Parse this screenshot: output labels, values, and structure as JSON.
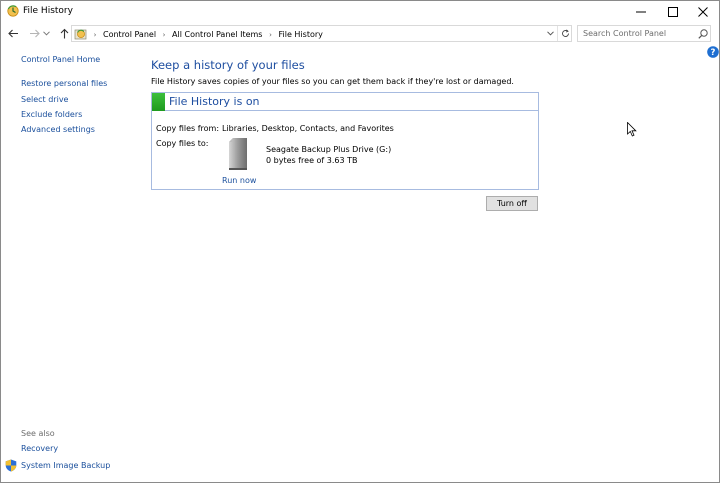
{
  "window": {
    "title": "File History",
    "icon": "file-history-icon"
  },
  "address_bar": {
    "breadcrumbs": [
      "Control Panel",
      "All Control Panel Items",
      "File History"
    ],
    "icon": "control-panel-icon"
  },
  "search": {
    "placeholder": "Search Control Panel"
  },
  "sidebar": {
    "home": "Control Panel Home",
    "items": [
      {
        "label": "Restore personal files"
      },
      {
        "label": "Select drive"
      },
      {
        "label": "Exclude folders"
      },
      {
        "label": "Advanced settings"
      }
    ],
    "see_also": "See also",
    "see_also_items": [
      {
        "label": "Recovery"
      },
      {
        "label": "System Image Backup",
        "icon": "shield-icon"
      }
    ]
  },
  "main": {
    "heading": "Keep a history of your files",
    "description": "File History saves copies of your files so you can get them back if they're lost or damaged.",
    "status": {
      "title": "File History is on",
      "color": "#2aa82a"
    },
    "copy_from_label": "Copy files from:",
    "copy_from_value": "Libraries, Desktop, Contacts, and Favorites",
    "copy_to_label": "Copy files to:",
    "drive": {
      "name": "Seagate Backup Plus Drive (G:)",
      "free": "0 bytes free of 3.63 TB",
      "icon": "external-drive-icon"
    },
    "run_now": "Run now",
    "turn_off": "Turn off"
  },
  "colors": {
    "link": "#1a4f9c",
    "heading": "#1e4ea0",
    "panel_border": "#a7bbe0"
  }
}
